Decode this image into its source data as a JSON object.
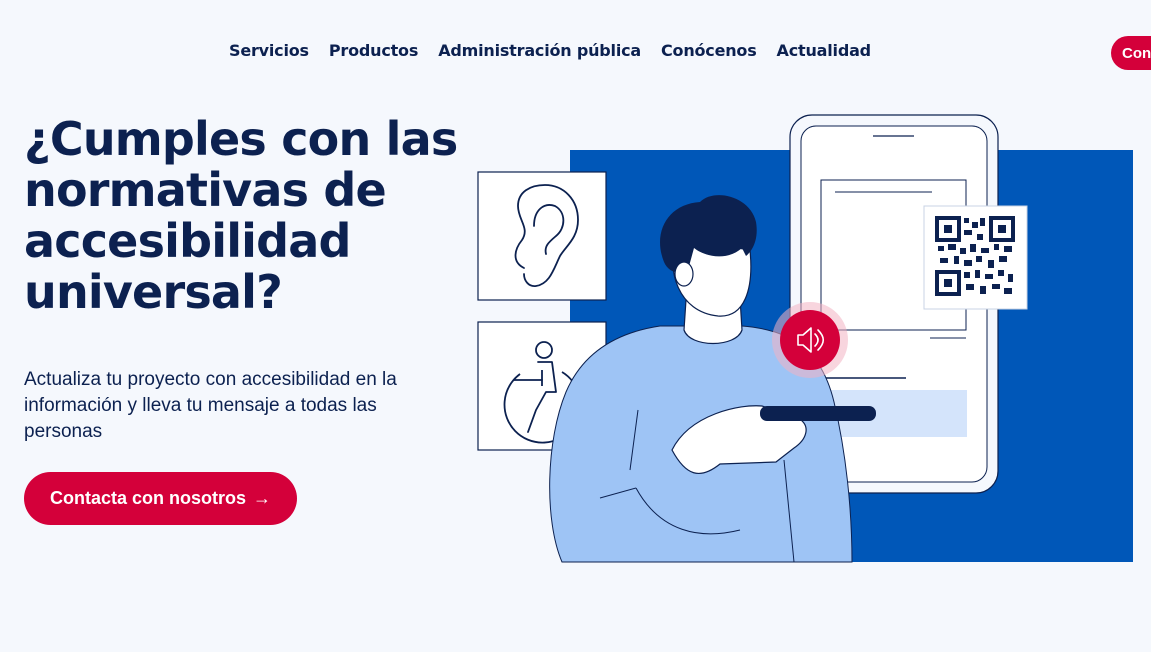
{
  "nav": {
    "items": [
      {
        "label": "Servicios"
      },
      {
        "label": "Productos"
      },
      {
        "label": "Administración pública"
      },
      {
        "label": "Conócenos"
      },
      {
        "label": "Actualidad"
      }
    ],
    "cta_label": "Contacta"
  },
  "hero": {
    "title": "¿Cumples con las normativas de accesibilidad universal?",
    "subtitle": "Actualiza tu proyecto con accesibilidad en la información y lleva tu mensaje a todas las personas",
    "button_label": "Contacta con nosotros",
    "button_arrow": "→"
  },
  "illustration": {
    "icons": [
      "ear-icon",
      "wheelchair-icon",
      "qr-code-icon",
      "speaker-icon"
    ]
  },
  "colors": {
    "background": "#f5f8fd",
    "navy": "#0c2150",
    "accent_red": "#d4003a",
    "brand_blue": "#0057b8",
    "shirt_blue": "#9ec4f5"
  }
}
